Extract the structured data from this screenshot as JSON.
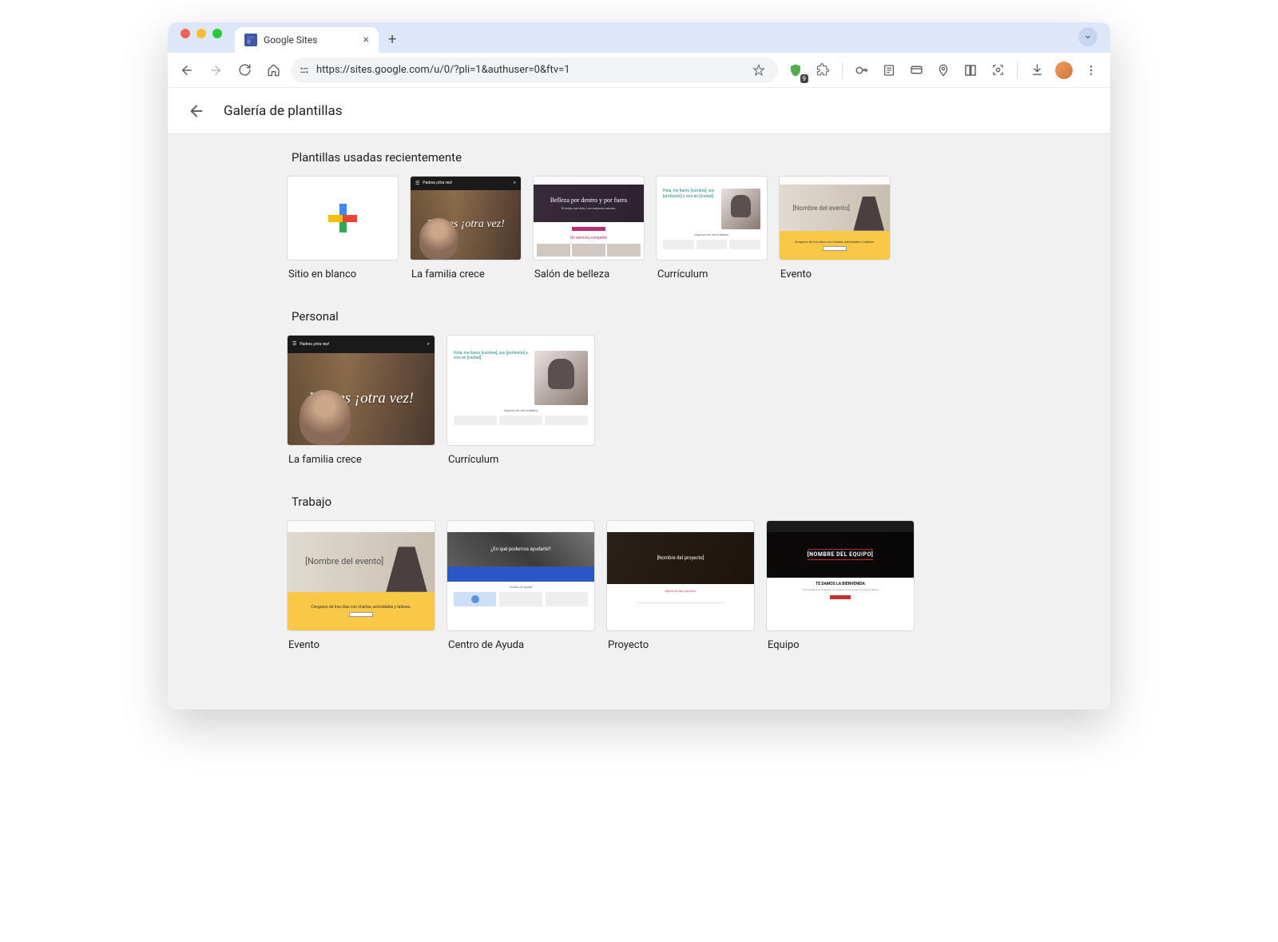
{
  "browser": {
    "tab_title": "Google Sites",
    "url": "https://sites.google.com/u/0/?pli=1&authuser=0&ftv=1",
    "ext_badge_count": "9"
  },
  "page": {
    "title": "Galería de plantillas"
  },
  "sections": [
    {
      "title": "Plantillas usadas recientemente",
      "size": "small",
      "templates": [
        {
          "variant": "blank",
          "label": "Sitio en blanco"
        },
        {
          "variant": "padres",
          "label": "La familia crece",
          "bar_text": "Padres ¡otra vez!",
          "hero_text": "Padres ¡otra vez!"
        },
        {
          "variant": "salon",
          "label": "Salón de belleza",
          "hero_text": "Belleza por dentro y por fuera",
          "sub_text": "Un servicio completo"
        },
        {
          "variant": "cv",
          "label": "Currículum",
          "cv_text": "Hola, me llamo [nombre], soy [profesión] y vivo en [ciudad].",
          "sub_text": "Algunos de mis trabajos"
        },
        {
          "variant": "evento",
          "label": "Evento",
          "hero_text": "[Nombre del evento]",
          "sub_text": "Congreso de tres días con charlas, actividades y talleres."
        }
      ]
    },
    {
      "title": "Personal",
      "size": "wide",
      "templates": [
        {
          "variant": "padres",
          "label": "La familia crece",
          "bar_text": "Padres ¡otra vez!",
          "hero_text": "Padres ¡otra vez!"
        },
        {
          "variant": "cv",
          "label": "Currículum",
          "cv_text": "Hola, me llamo [nombre], soy [profesión] y vivo en [ciudad].",
          "sub_text": "Algunos de mis trabajos"
        }
      ]
    },
    {
      "title": "Trabajo",
      "size": "wide",
      "templates": [
        {
          "variant": "evento",
          "label": "Evento",
          "hero_text": "[Nombre del evento]",
          "sub_text": "Congreso de tres días con charlas, actividades y talleres."
        },
        {
          "variant": "ayuda",
          "label": "Centro de Ayuda",
          "hero_text": "¿En qué podemos ayudarte?",
          "sec_text": "Temas de ayuda"
        },
        {
          "variant": "proyecto",
          "label": "Proyecto",
          "hero_text": "[Nombre del proyecto]",
          "sec_text": "Objetivos del proyecto"
        },
        {
          "variant": "equipo",
          "label": "Equipo",
          "hero_text": "[NOMBRE DEL EQUIPO]",
          "welcome": "TE DAMOS LA BIENVENIDA"
        }
      ]
    }
  ]
}
